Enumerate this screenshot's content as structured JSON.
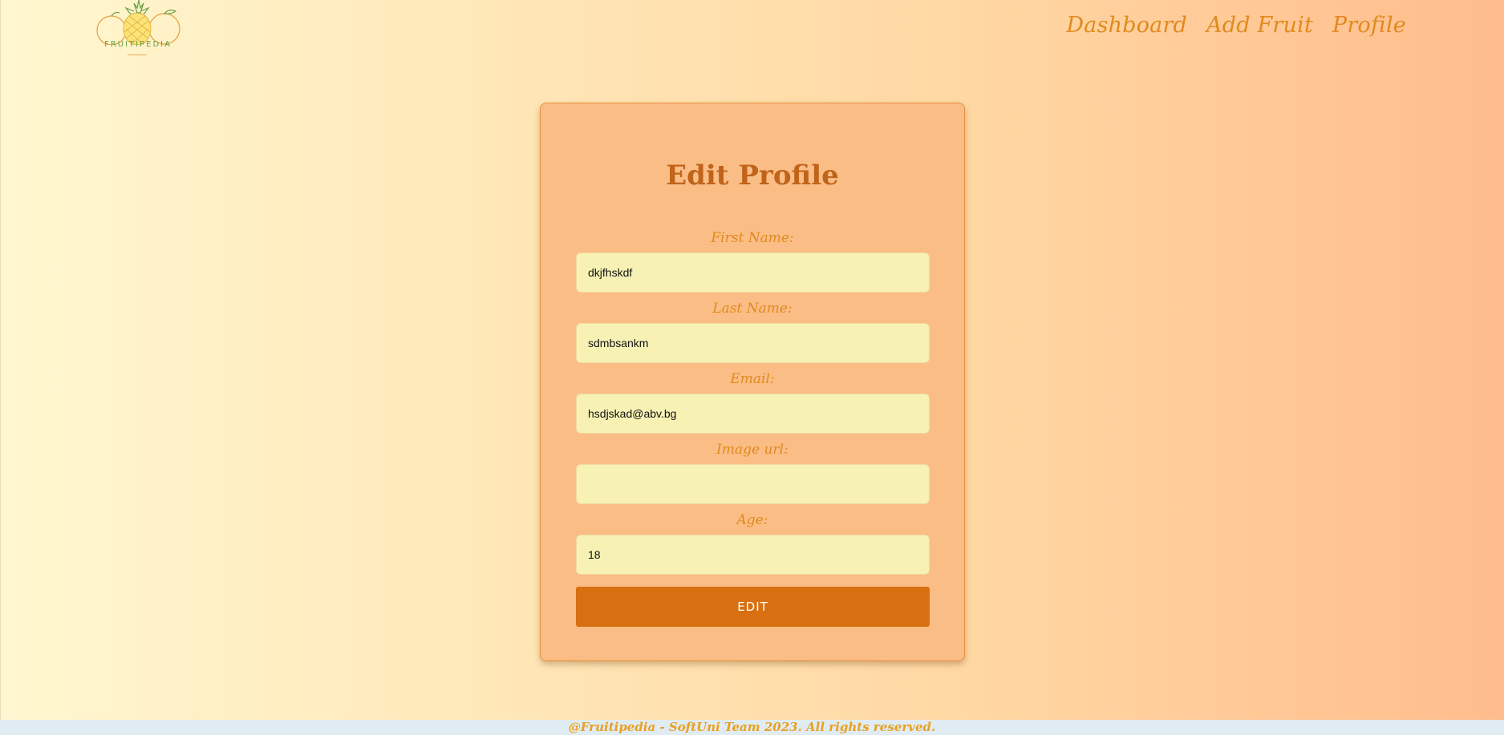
{
  "header": {
    "logo_text": "FRUITIPEDIA",
    "nav": [
      {
        "label": "Dashboard"
      },
      {
        "label": "Add Fruit"
      },
      {
        "label": "Profile"
      }
    ]
  },
  "form": {
    "title": "Edit Profile",
    "fields": {
      "first_name": {
        "label": "First Name:",
        "value": "dkjfhskdf"
      },
      "last_name": {
        "label": "Last Name:",
        "value": "sdmbsankm"
      },
      "email": {
        "label": "Email:",
        "value": "hsdjskad@abv.bg"
      },
      "image_url": {
        "label": "Image url:",
        "value": ""
      },
      "age": {
        "label": "Age:",
        "value": "18"
      }
    },
    "submit_label": "EDIT"
  },
  "footer": {
    "text": "@Fruitipedia - SoftUni Team 2023. All rights reserved."
  },
  "colors": {
    "accent": "#e08a1e",
    "button": "#d86f10",
    "card": "#fbbd86",
    "input_bg": "#f7f2b4",
    "title": "#c0641a"
  }
}
